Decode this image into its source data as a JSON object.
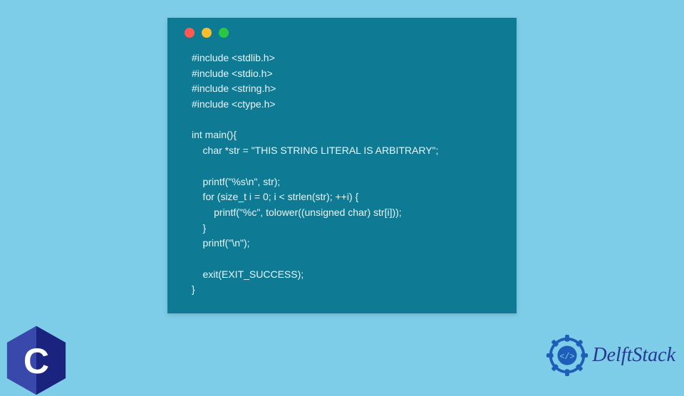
{
  "code": {
    "lines": [
      "#include <stdlib.h>",
      "#include <stdio.h>",
      "#include <string.h>",
      "#include <ctype.h>",
      "",
      "int main(){",
      "    char *str = \"THIS STRING LITERAL IS ARBITRARY\";",
      "",
      "    printf(\"%s\\n\", str);",
      "    for (size_t i = 0; i < strlen(str); ++i) {",
      "        printf(\"%c\", tolower((unsigned char) str[i]));",
      "    }",
      "    printf(\"\\n\");",
      "",
      "    exit(EXIT_SUCCESS);",
      "}"
    ]
  },
  "brand": {
    "name": "DelftStack"
  },
  "language_badge": {
    "letter": "C"
  },
  "colors": {
    "page_bg": "#7ecde8",
    "window_bg": "#0f7a94",
    "code_text": "#e8f6fa",
    "brand_text": "#233a8f",
    "dot_red": "#ff5a52",
    "dot_yellow": "#f7bf2f",
    "dot_green": "#2ac840"
  }
}
